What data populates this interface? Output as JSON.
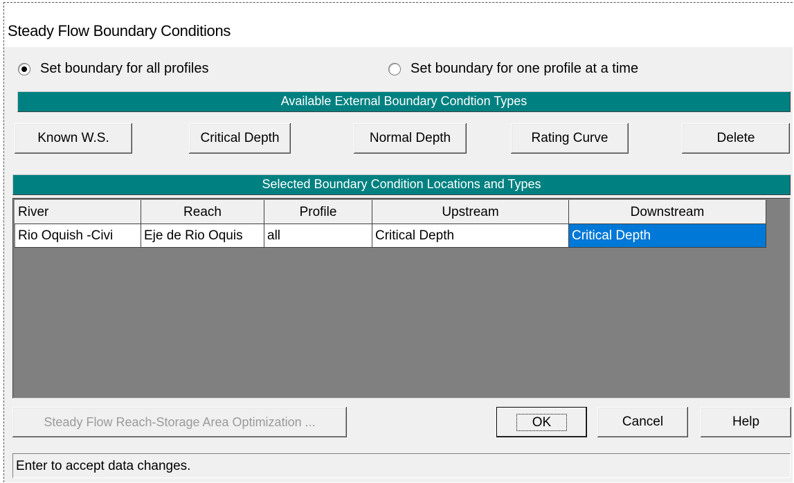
{
  "window": {
    "title": "Steady Flow Boundary Conditions"
  },
  "mode": {
    "all_profiles_label": "Set boundary for all profiles",
    "one_profile_label": "Set boundary for one profile at a time",
    "selected": "all_profiles"
  },
  "available_types": {
    "header": "Available External Boundary Condtion Types",
    "buttons": {
      "known_ws": "Known W.S.",
      "critical_depth": "Critical Depth",
      "normal_depth": "Normal Depth",
      "rating_curve": "Rating Curve",
      "delete": "Delete"
    }
  },
  "selected_locations": {
    "header": "Selected Boundary Condition Locations and Types",
    "columns": [
      "River",
      "Reach",
      "Profile",
      "Upstream",
      "Downstream"
    ],
    "rows": [
      [
        "Rio Oquish -Civi",
        "Eje de Rio Oquis",
        "all",
        "Critical Depth",
        "Critical Depth"
      ]
    ]
  },
  "footer_buttons": {
    "optimization": "Steady Flow Reach-Storage Area Optimization ...",
    "ok": "OK",
    "cancel": "Cancel",
    "help": "Help"
  },
  "status": {
    "text": "Enter to accept data changes."
  },
  "colors": {
    "header_bar": "#008080",
    "selection": "#0078d7",
    "grid_background": "#808080"
  }
}
